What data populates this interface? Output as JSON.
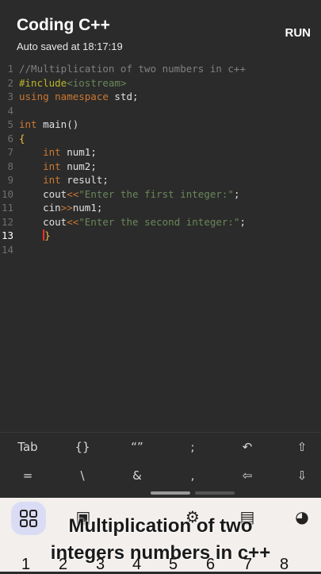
{
  "header": {
    "title": "Coding C++",
    "subtitle": "Auto saved at 18:17:19",
    "run_label": "RUN"
  },
  "editor": {
    "active_line": 13,
    "lines": [
      {
        "n": "1",
        "tokens": [
          {
            "c": "cm",
            "t": "//Multiplication of two numbers in c++"
          }
        ]
      },
      {
        "n": "2",
        "tokens": [
          {
            "c": "pp",
            "t": "#include"
          },
          {
            "c": "st",
            "t": "<iostream>"
          }
        ]
      },
      {
        "n": "3",
        "tokens": [
          {
            "c": "kw",
            "t": "using namespace"
          },
          {
            "c": "tx",
            "t": " std;"
          }
        ]
      },
      {
        "n": "4",
        "tokens": []
      },
      {
        "n": "5",
        "tokens": [
          {
            "c": "kw",
            "t": "int"
          },
          {
            "c": "tx",
            "t": " main()"
          }
        ]
      },
      {
        "n": "6",
        "tokens": [
          {
            "c": "br",
            "t": "{"
          }
        ]
      },
      {
        "n": "7",
        "tokens": [
          {
            "c": "tx",
            "t": "    "
          },
          {
            "c": "kw",
            "t": "int"
          },
          {
            "c": "tx",
            "t": " num1;"
          }
        ]
      },
      {
        "n": "8",
        "tokens": [
          {
            "c": "tx",
            "t": "    "
          },
          {
            "c": "kw",
            "t": "int"
          },
          {
            "c": "tx",
            "t": " num2;"
          }
        ]
      },
      {
        "n": "9",
        "tokens": [
          {
            "c": "tx",
            "t": "    "
          },
          {
            "c": "kw",
            "t": "int"
          },
          {
            "c": "tx",
            "t": " result;"
          }
        ]
      },
      {
        "n": "10",
        "tokens": [
          {
            "c": "tx",
            "t": "    cout"
          },
          {
            "c": "op",
            "t": "<<"
          },
          {
            "c": "st",
            "t": "\"Enter the first integer:\""
          },
          {
            "c": "tx",
            "t": ";"
          }
        ]
      },
      {
        "n": "11",
        "tokens": [
          {
            "c": "tx",
            "t": "    cin"
          },
          {
            "c": "op",
            "t": ">>"
          },
          {
            "c": "tx",
            "t": "num1;"
          }
        ]
      },
      {
        "n": "12",
        "tokens": [
          {
            "c": "tx",
            "t": "    cout"
          },
          {
            "c": "op",
            "t": "<<"
          },
          {
            "c": "st",
            "t": "\"Enter the second integer:\""
          },
          {
            "c": "tx",
            "t": ";"
          }
        ]
      },
      {
        "n": "13",
        "tokens": [
          {
            "c": "tx",
            "t": "    "
          },
          {
            "c": "cursor",
            "t": ""
          },
          {
            "c": "br",
            "t": "}"
          }
        ]
      },
      {
        "n": "14",
        "tokens": []
      }
    ]
  },
  "symbol_keys": {
    "row1": [
      "Tab",
      "{}",
      "“”",
      ";",
      "↶",
      "⇧"
    ],
    "row2": [
      "=",
      "\\",
      "&",
      ",",
      "⇦",
      "⇩"
    ]
  },
  "bottom": {
    "caption_line1": "Multiplication of two",
    "caption_line2": "integers numbers in c++",
    "numbers": [
      "1",
      "2",
      "3",
      "4",
      "5",
      "6",
      "7",
      "8"
    ]
  },
  "colors": {
    "background": "#2b2b2b",
    "keyword": "#cc7832",
    "string": "#6a8759",
    "comment": "#808080"
  }
}
